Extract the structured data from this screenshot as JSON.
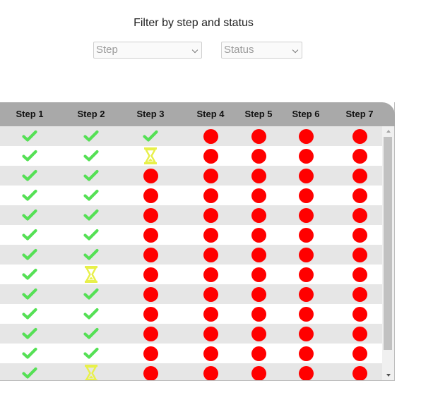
{
  "filter": {
    "title": "Filter by step and status",
    "step_select": {
      "value": "Step"
    },
    "status_select": {
      "value": "Status"
    }
  },
  "table": {
    "columns": [
      "Step 1",
      "Step 2",
      "Step 3",
      "Step 4",
      "Step 5",
      "Step 6",
      "Step 7"
    ],
    "rows": [
      [
        "done",
        "done",
        "done",
        "not-started",
        "not-started",
        "not-started",
        "not-started"
      ],
      [
        "done",
        "done",
        "pending",
        "not-started",
        "not-started",
        "not-started",
        "not-started"
      ],
      [
        "done",
        "done",
        "not-started",
        "not-started",
        "not-started",
        "not-started",
        "not-started"
      ],
      [
        "done",
        "done",
        "not-started",
        "not-started",
        "not-started",
        "not-started",
        "not-started"
      ],
      [
        "done",
        "done",
        "not-started",
        "not-started",
        "not-started",
        "not-started",
        "not-started"
      ],
      [
        "done",
        "done",
        "not-started",
        "not-started",
        "not-started",
        "not-started",
        "not-started"
      ],
      [
        "done",
        "done",
        "not-started",
        "not-started",
        "not-started",
        "not-started",
        "not-started"
      ],
      [
        "done",
        "pending",
        "not-started",
        "not-started",
        "not-started",
        "not-started",
        "not-started"
      ],
      [
        "done",
        "done",
        "not-started",
        "not-started",
        "not-started",
        "not-started",
        "not-started"
      ],
      [
        "done",
        "done",
        "not-started",
        "not-started",
        "not-started",
        "not-started",
        "not-started"
      ],
      [
        "done",
        "done",
        "not-started",
        "not-started",
        "not-started",
        "not-started",
        "not-started"
      ],
      [
        "done",
        "done",
        "not-started",
        "not-started",
        "not-started",
        "not-started",
        "not-started"
      ],
      [
        "done",
        "pending",
        "not-started",
        "not-started",
        "not-started",
        "not-started",
        "not-started"
      ]
    ],
    "status_icons": {
      "done": {
        "icon": "check-icon",
        "color": "#55e055"
      },
      "pending": {
        "icon": "hourglass-icon",
        "color": "#e8f04a"
      },
      "not-started": {
        "icon": "red-dot-icon",
        "color": "#ff0000"
      }
    },
    "header_color": "#a9a9a9",
    "shade_color": "#e6e6e6"
  }
}
